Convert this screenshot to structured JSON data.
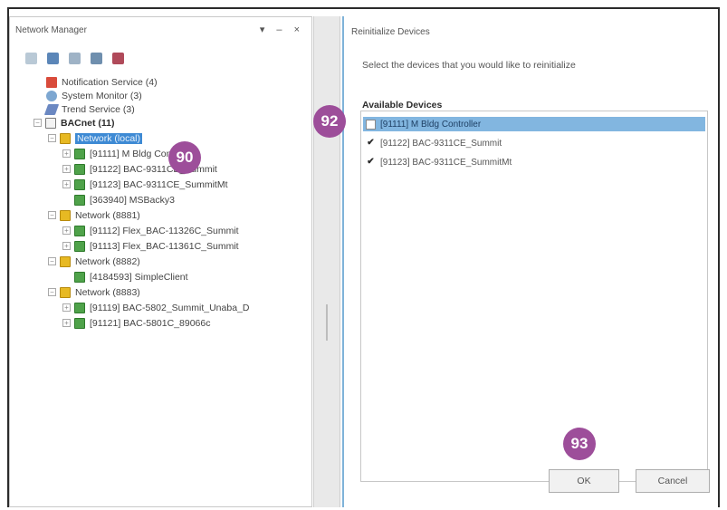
{
  "left_pane": {
    "title": "Network Manager",
    "controls": "▾ – ×",
    "toolbar_icons": [
      "refresh-icon",
      "properties-icon",
      "list-icon",
      "folder-icon",
      "delete-icon"
    ],
    "tree": [
      {
        "label": "Notification Service (4)",
        "icon": "notification-icon"
      },
      {
        "label": "System Monitor (3)",
        "icon": "system-monitor-icon"
      },
      {
        "label": "Trend Service (3)",
        "icon": "trend-icon"
      },
      {
        "label": "BACnet (11)",
        "icon": "bacnet-icon"
      },
      {
        "label": "Network (local)",
        "icon": "network-icon"
      },
      {
        "label": "[91111] M Bldg Controller",
        "icon": "device-icon"
      },
      {
        "label": "[91122] BAC-9311CE_Summit",
        "icon": "device-icon"
      },
      {
        "label": "[91123] BAC-9311CE_SummitMt",
        "icon": "device-icon"
      },
      {
        "label": "[363940] MSBacky3",
        "icon": "device-icon"
      },
      {
        "label": "Network (8881)",
        "icon": "network-icon"
      },
      {
        "label": "[91112] Flex_BAC-11326C_Summit",
        "icon": "device-icon"
      },
      {
        "label": "[91113] Flex_BAC-11361C_Summit",
        "icon": "device-icon"
      },
      {
        "label": "Network (8882)",
        "icon": "network-icon"
      },
      {
        "label": "[4184593] SimpleClient",
        "icon": "device-icon"
      },
      {
        "label": "Network (8883)",
        "icon": "network-icon"
      },
      {
        "label": "[91119] BAC-5802_Summit_Unaba_D",
        "icon": "device-icon"
      },
      {
        "label": "[91121] BAC-5801C_89066c",
        "icon": "device-icon"
      }
    ]
  },
  "dialog": {
    "title": "Reinitialize Devices",
    "instruction": "Select the devices that you would like to reinitialize",
    "available_label": "Available Devices",
    "devices": [
      {
        "label": "[91111] M Bldg Controller",
        "checked": false,
        "selected": true
      },
      {
        "label": "[91122] BAC-9311CE_Summit",
        "checked": true,
        "selected": false
      },
      {
        "label": "[91123] BAC-9311CE_SummitMt",
        "checked": true,
        "selected": false
      }
    ],
    "ok_label": "OK",
    "cancel_label": "Cancel",
    "check_glyph": "✔"
  },
  "callouts": {
    "c90": "90",
    "c92": "92",
    "c93": "93"
  },
  "colors": {
    "callout": "#9d4e9a",
    "selection": "#3e8ad4",
    "list_selection": "#82b6e0"
  }
}
